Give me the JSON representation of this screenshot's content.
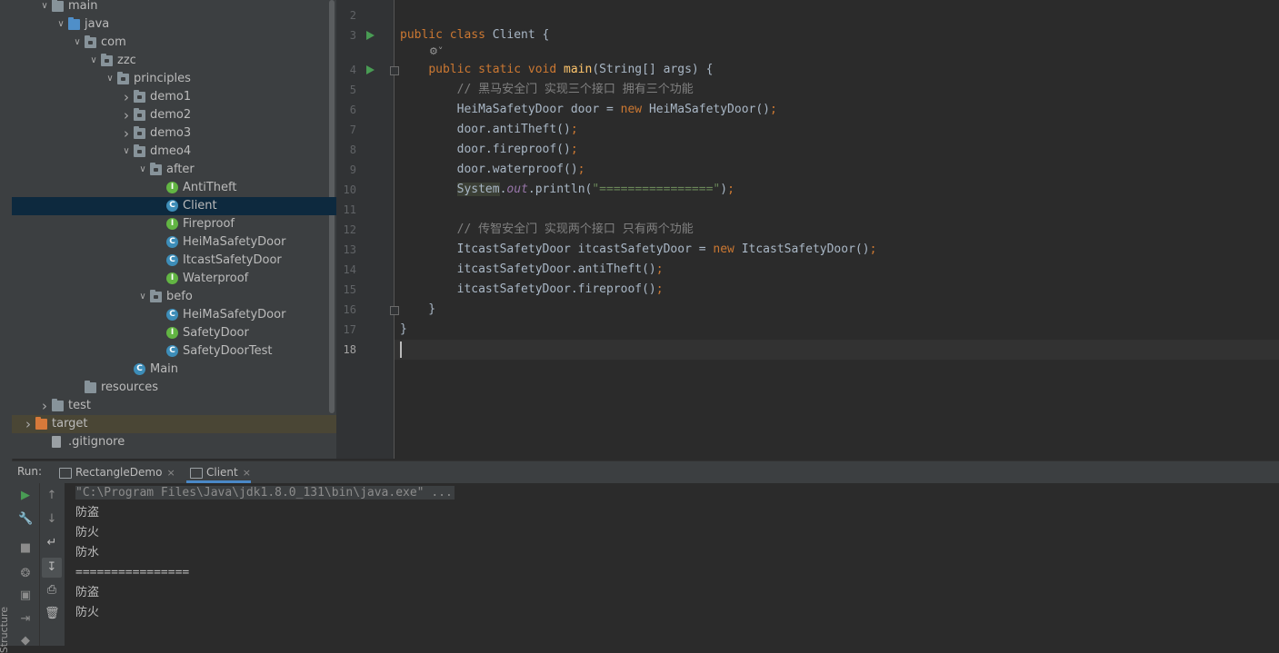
{
  "sidebar": {
    "structure_label": "Structure"
  },
  "tree": [
    {
      "label": "main",
      "depth": 2,
      "type": "folder",
      "expanded": true
    },
    {
      "label": "java",
      "depth": 3,
      "type": "folder-blue",
      "expanded": true
    },
    {
      "label": "com",
      "depth": 4,
      "type": "package",
      "expanded": true
    },
    {
      "label": "zzc",
      "depth": 5,
      "type": "package",
      "expanded": true
    },
    {
      "label": "principles",
      "depth": 6,
      "type": "package",
      "expanded": true
    },
    {
      "label": "demo1",
      "depth": 7,
      "type": "package",
      "expanded": false
    },
    {
      "label": "demo2",
      "depth": 7,
      "type": "package",
      "expanded": false
    },
    {
      "label": "demo3",
      "depth": 7,
      "type": "package",
      "expanded": false
    },
    {
      "label": "dmeo4",
      "depth": 7,
      "type": "package",
      "expanded": true
    },
    {
      "label": "after",
      "depth": 8,
      "type": "package",
      "expanded": true
    },
    {
      "label": "AntiTheft",
      "depth": 9,
      "type": "interface"
    },
    {
      "label": "Client",
      "depth": 9,
      "type": "class",
      "selected": true
    },
    {
      "label": "Fireproof",
      "depth": 9,
      "type": "interface"
    },
    {
      "label": "HeiMaSafetyDoor",
      "depth": 9,
      "type": "class"
    },
    {
      "label": "ItcastSafetyDoor",
      "depth": 9,
      "type": "class"
    },
    {
      "label": "Waterproof",
      "depth": 9,
      "type": "interface"
    },
    {
      "label": "befo",
      "depth": 8,
      "type": "package",
      "expanded": true
    },
    {
      "label": "HeiMaSafetyDoor",
      "depth": 9,
      "type": "class"
    },
    {
      "label": "SafetyDoor",
      "depth": 9,
      "type": "interface"
    },
    {
      "label": "SafetyDoorTest",
      "depth": 9,
      "type": "class"
    },
    {
      "label": "Main",
      "depth": 7,
      "type": "class-main"
    },
    {
      "label": "resources",
      "depth": 4,
      "type": "folder"
    },
    {
      "label": "test",
      "depth": 2,
      "type": "folder",
      "expanded": false
    },
    {
      "label": "target",
      "depth": 1,
      "type": "folder-orange",
      "expanded": false,
      "highlight": true
    },
    {
      "label": ".gitignore",
      "depth": 2,
      "type": "file"
    }
  ],
  "editor": {
    "line_numbers": [
      "2",
      "3",
      "4",
      "5",
      "6",
      "7",
      "8",
      "9",
      "10",
      "11",
      "12",
      "13",
      "14",
      "15",
      "16",
      "17",
      "18"
    ],
    "current_line": "18",
    "hint_icon": "settings-hint-icon",
    "lines": [
      {
        "n": "2",
        "t": []
      },
      {
        "n": "3",
        "t": [
          [
            "kw",
            "public class "
          ],
          [
            "id",
            "Client {"
          ]
        ]
      },
      {
        "n": "4",
        "t": [
          [
            "id",
            "    "
          ],
          [
            "kw",
            "public static void "
          ],
          [
            "fn",
            "main"
          ],
          [
            "id",
            "(String[] args) {"
          ]
        ]
      },
      {
        "n": "5",
        "t": [
          [
            "cm",
            "        // 黑马安全门 实现三个接口 拥有三个功能"
          ]
        ]
      },
      {
        "n": "6",
        "t": [
          [
            "id",
            "        HeiMaSafetyDoor door = "
          ],
          [
            "kw",
            "new "
          ],
          [
            "id",
            "HeiMaSafetyDoor()"
          ],
          [
            "kw",
            ";"
          ]
        ]
      },
      {
        "n": "7",
        "t": [
          [
            "id",
            "        door.antiTheft()"
          ],
          [
            "kw",
            ";"
          ]
        ]
      },
      {
        "n": "8",
        "t": [
          [
            "id",
            "        door.fireproof()"
          ],
          [
            "kw",
            ";"
          ]
        ]
      },
      {
        "n": "9",
        "t": [
          [
            "id",
            "        door.waterproof()"
          ],
          [
            "kw",
            ";"
          ]
        ]
      },
      {
        "n": "10",
        "t": [
          [
            "id",
            "        "
          ],
          [
            "sys",
            "System"
          ],
          [
            "id",
            "."
          ],
          [
            "fld",
            "out"
          ],
          [
            "id",
            ".println("
          ],
          [
            "st",
            "\"================\""
          ],
          [
            "id",
            ")"
          ],
          [
            "kw",
            ";"
          ]
        ]
      },
      {
        "n": "11",
        "t": []
      },
      {
        "n": "12",
        "t": [
          [
            "cm",
            "        // 传智安全门 实现两个接口 只有两个功能"
          ]
        ]
      },
      {
        "n": "13",
        "t": [
          [
            "id",
            "        ItcastSafetyDoor itcastSafetyDoor = "
          ],
          [
            "kw",
            "new "
          ],
          [
            "id",
            "ItcastSafetyDoor()"
          ],
          [
            "kw",
            ";"
          ]
        ]
      },
      {
        "n": "14",
        "t": [
          [
            "id",
            "        itcastSafetyDoor.antiTheft()"
          ],
          [
            "kw",
            ";"
          ]
        ]
      },
      {
        "n": "15",
        "t": [
          [
            "id",
            "        itcastSafetyDoor.fireproof()"
          ],
          [
            "kw",
            ";"
          ]
        ]
      },
      {
        "n": "16",
        "t": [
          [
            "id",
            "    }"
          ]
        ]
      },
      {
        "n": "17",
        "t": [
          [
            "id",
            "}"
          ]
        ]
      },
      {
        "n": "18",
        "t": []
      }
    ]
  },
  "run": {
    "label": "Run:",
    "tabs": [
      {
        "label": "RectangleDemo",
        "close": "×",
        "active": false
      },
      {
        "label": "Client",
        "close": "×",
        "active": true
      }
    ],
    "console": [
      "\"C:\\Program Files\\Java\\jdk1.8.0_131\\bin\\java.exe\" ...",
      "防盗",
      "防火",
      "防水",
      "================",
      "防盗",
      "防火"
    ]
  },
  "colors": {
    "accent": "#4a88c7",
    "run_green": "#499c54",
    "keyword": "#cc7832",
    "function": "#ffc66d",
    "comment": "#808080",
    "string": "#6a8759"
  }
}
